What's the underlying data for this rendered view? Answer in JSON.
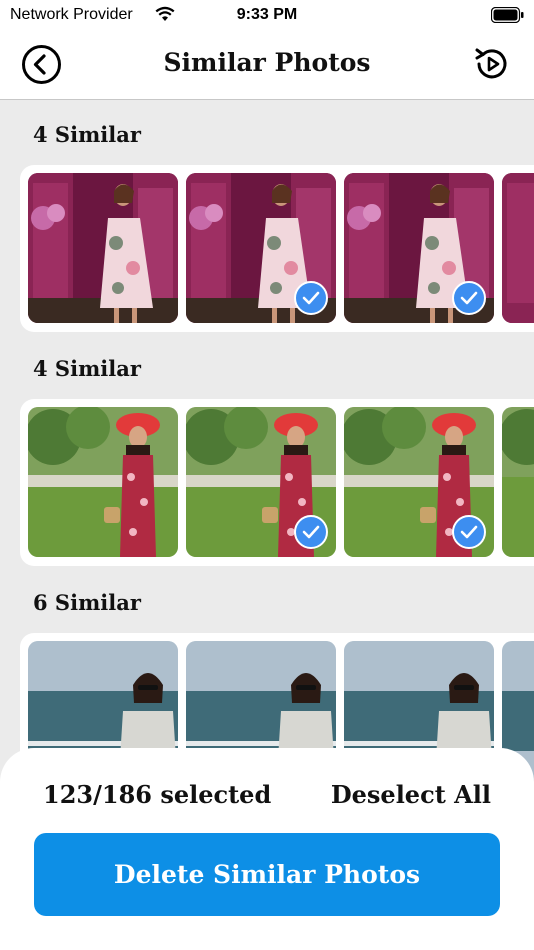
{
  "status_bar": {
    "carrier": "Network Provider",
    "time": "9:33 PM",
    "icons": [
      "wifi-icon",
      "battery-icon"
    ]
  },
  "nav": {
    "title": "Similar Photos",
    "left_icon": "back-circle-icon",
    "right_icon": "restore-icon"
  },
  "groups": [
    {
      "title": "4 Similar",
      "photos": [
        {
          "selected": false
        },
        {
          "selected": true
        },
        {
          "selected": true
        }
      ]
    },
    {
      "title": "4 Similar",
      "photos": [
        {
          "selected": false
        },
        {
          "selected": true
        },
        {
          "selected": true
        }
      ]
    },
    {
      "title": "6 Similar",
      "photos": [
        {
          "selected": false
        },
        {
          "selected": false
        },
        {
          "selected": false
        }
      ]
    }
  ],
  "footer": {
    "selected_text": "123/186 selected",
    "deselect_label": "Deselect All",
    "delete_label": "Delete Similar Photos"
  },
  "colors": {
    "accent": "#0d8fe6",
    "check": "#3d8ef0",
    "background": "#ebebeb"
  }
}
